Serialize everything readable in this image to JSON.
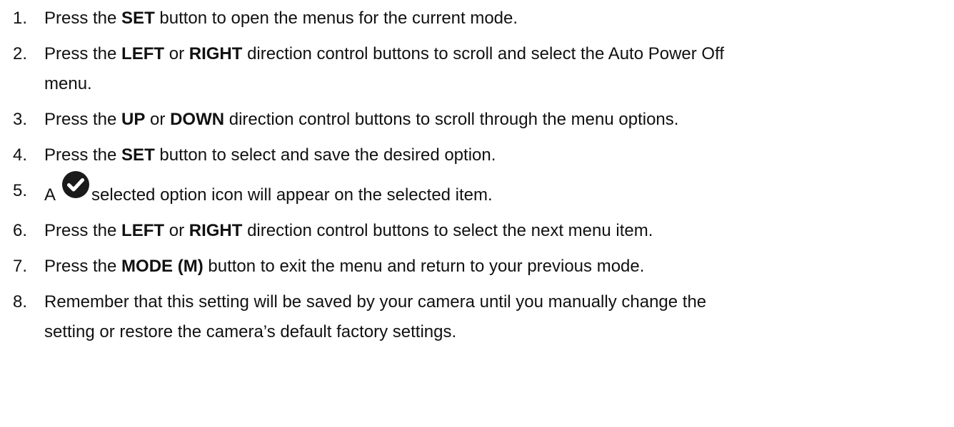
{
  "steps": [
    {
      "num": "1.",
      "parts": [
        {
          "t": "Press the ",
          "b": false
        },
        {
          "t": "SET",
          "b": true
        },
        {
          "t": " button to open the menus for the current mode.",
          "b": false
        }
      ]
    },
    {
      "num": "2.",
      "parts": [
        {
          "t": "Press the ",
          "b": false
        },
        {
          "t": "LEFT",
          "b": true
        },
        {
          "t": " or ",
          "b": false
        },
        {
          "t": "RIGHT",
          "b": true
        },
        {
          "t": " direction control buttons to scroll and select the Auto Power Off",
          "b": false
        }
      ],
      "continuation": "menu."
    },
    {
      "num": "3.",
      "parts": [
        {
          "t": "Press the ",
          "b": false
        },
        {
          "t": "UP",
          "b": true
        },
        {
          "t": " or ",
          "b": false
        },
        {
          "t": "DOWN",
          "b": true
        },
        {
          "t": " direction control buttons to scroll through the menu options.",
          "b": false
        }
      ]
    },
    {
      "num": "4.",
      "parts": [
        {
          "t": "Press the ",
          "b": false
        },
        {
          "t": "SET",
          "b": true
        },
        {
          "t": " button to select and save the desired option.",
          "b": false
        }
      ]
    },
    {
      "num": "5.",
      "parts": [
        {
          "t": "A",
          "b": false
        },
        {
          "icon": "check-circle-icon"
        },
        {
          "t": "selected option icon will appear on the selected item.",
          "b": false
        }
      ]
    },
    {
      "num": "6.",
      "parts": [
        {
          "t": "Press the ",
          "b": false
        },
        {
          "t": "LEFT",
          "b": true
        },
        {
          "t": " or ",
          "b": false
        },
        {
          "t": "RIGHT",
          "b": true
        },
        {
          "t": " direction control buttons to select the next menu item.",
          "b": false
        }
      ]
    },
    {
      "num": "7.",
      "parts": [
        {
          "t": "Press the ",
          "b": false
        },
        {
          "t": "MODE (M)",
          "b": true
        },
        {
          "t": " button to exit the menu and return to your previous mode.",
          "b": false
        }
      ]
    },
    {
      "num": "8.",
      "parts": [
        {
          "t": "Remember that this setting will be saved by your camera until you manually change the",
          "b": false
        }
      ],
      "continuation": "setting or restore the camera’s default factory settings."
    }
  ],
  "colors": {
    "text": "#111111",
    "icon": "#1a1a1a"
  }
}
